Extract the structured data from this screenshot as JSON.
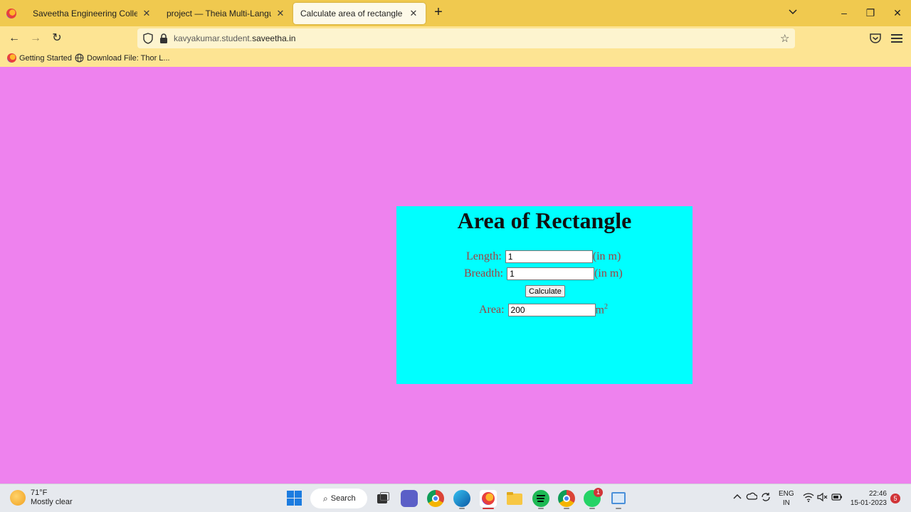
{
  "browser": {
    "tabs": [
      {
        "title": "Saveetha Engineering College",
        "active": false
      },
      {
        "title": "project — Theia Multi-Language Ex",
        "active": false
      },
      {
        "title": "Calculate area of rectangle",
        "active": true
      }
    ],
    "url_prefix": "kavyakumar.student.",
    "url_domain": "saveetha.in",
    "bookmarks": [
      {
        "label": "Getting Started",
        "icon": "firefox-icon"
      },
      {
        "label": "Download File: Thor L...",
        "icon": "globe-icon"
      }
    ]
  },
  "page": {
    "heading": "Area of Rectangle",
    "length_label": "Length:",
    "length_value": "1",
    "length_unit": "(in m)",
    "breadth_label": "Breadth:",
    "breadth_value": "1",
    "breadth_unit": "(in m)",
    "calculate_label": "Calculate",
    "area_label": "Area:",
    "area_value": "200",
    "area_unit": "m",
    "area_unit_exp": "2",
    "colors": {
      "page_bg": "#ee82ee",
      "box_bg": "#00ffff",
      "label_color": "#a04040"
    }
  },
  "taskbar": {
    "temperature": "71°F",
    "weather": "Mostly clear",
    "search_label": "Search",
    "whatsapp_badge": "1",
    "lang_line1": "ENG",
    "lang_line2": "IN",
    "time": "22:46",
    "date": "15-01-2023",
    "notifications": "5"
  }
}
